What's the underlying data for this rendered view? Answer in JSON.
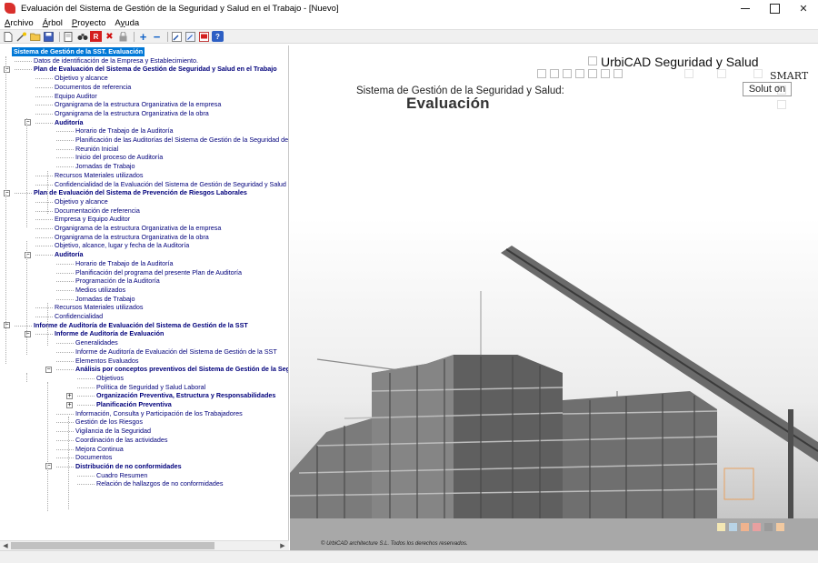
{
  "window": {
    "title": "Evaluación del Sistema de Gestión de la Seguridad y Salud en el Trabajo - [Nuevo]",
    "minimize_icon": "minimize-icon",
    "maximize_icon": "maximize-icon",
    "close_symbol": "✕"
  },
  "menu": [
    {
      "label": "Archivo",
      "u": "A",
      "rest": "rchivo"
    },
    {
      "label": "Árbol",
      "u": "Á",
      "rest": "rbol"
    },
    {
      "label": "Proyecto",
      "u": "P",
      "rest": "royecto"
    },
    {
      "label": "Ayuda",
      "u": "y",
      "pre": "A",
      "rest": "uda"
    }
  ],
  "toolbar": {
    "icons": [
      "new-document-icon",
      "wizard-icon",
      "open-folder-icon",
      "save-icon",
      "print-preview-icon",
      "binoculars-icon",
      "report-icon",
      "delete-icon",
      "lock-icon",
      "add-icon",
      "remove-icon",
      "edit-icon",
      "notes-icon",
      "pdf-icon",
      "help-icon"
    ],
    "report_glyph": "R",
    "delete_glyph": "✖",
    "add_glyph": "+",
    "remove_glyph": "−",
    "help_glyph": "?"
  },
  "tree": {
    "root": "Sistema de Gestión de la SST. Evaluación",
    "items": [
      "Datos de identificación de la Empresa y Establecimiento.",
      "Plan de Evaluación del Sistema de Gestión de Seguridad y Salud en el Trabajo",
      "Objetivo y alcance",
      "Documentos de referencia",
      "Equipo Auditor",
      "Organigrama de la estructura Organizativa de la empresa",
      "Organigrama de la estructura Organizativa de la obra",
      "Auditoría",
      "Horario de Trabajo de la Auditoría",
      "Planificación de las Auditorías del Sistema de Gestión de la Seguridad de la obra",
      "Reunión Inicial",
      "Inicio del proceso de Auditoría",
      "Jornadas de Trabajo",
      "Recursos Materiales utilizados",
      "Confidencialidad de la Evaluación del Sistema de Gestión de Seguridad y Salud en el Trab",
      "Plan de Evaluación del Sistema de Prevención de Riesgos Laborales",
      "Objetivo y alcance",
      "Documentación de referencia",
      "Empresa y Equipo Auditor",
      "Organigrama de la estructura Organizativa de la empresa",
      "Organigrama de la estructura Organizativa de la obra",
      "Objetivo, alcance, lugar y fecha de la Auditoría",
      "Auditoría",
      "Horario de Trabajo de la Auditoría",
      "Planificación del programa del presente Plan de Auditoría",
      "Programación de la Auditoría",
      "Medios utilizados",
      "Jornadas de Trabajo",
      "Recursos Materiales utilizados",
      "Confidencialidad",
      "Informe de Auditoría de Evaluación del Sistema de Gestión de la SST",
      "Informe de Auditoría de Evaluación",
      "Generalidades",
      "Informe de Auditoría de Evaluación del Sistema de Gestión de la SST",
      "Elementos Evaluados",
      "Análisis por conceptos preventivos del Sistema de Gestión de la Seg",
      "Objetivos",
      "Política de Seguridad y Salud Laboral",
      "Organización Preventiva, Estructura y Responsabilidades",
      "Planificación Preventiva",
      "Información, Consulta y Participación de los Trabajadores",
      "Gestión de los Riesgos",
      "Vigilancia de la Seguridad",
      "Coordinación de las actividades",
      "Mejora Continua",
      "Documentos",
      "Distribución de no conformidades",
      "Cuadro Resumen",
      "Relación de hallazgos de no conformidades"
    ],
    "minus": "−",
    "plus": "+"
  },
  "scrollbar": {
    "left": "◀",
    "right": "▶"
  },
  "splash": {
    "brand": "UrbiCAD Seguridad y Salud",
    "smart": "SMART",
    "solution": "Solut on",
    "subtitle": "Sistema de Gestión de la Seguridad y Salud:",
    "heading": "Evaluación",
    "copyright": "© UrbiCAD architecture S.L. Todos los derechos reservados."
  },
  "colors": {
    "tree_text": "#00007b",
    "selection": "#0078d7",
    "app_icon": "#d9302c"
  }
}
